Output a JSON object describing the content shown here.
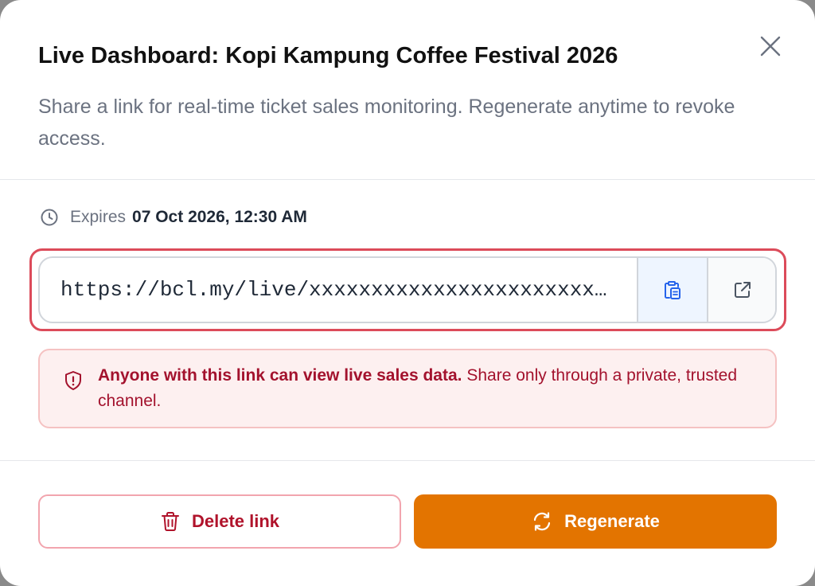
{
  "dialog": {
    "title": "Live Dashboard: Kopi Kampung Coffee Festival 2026",
    "subtitle": "Share a link for real-time ticket sales monitoring. Regenerate anytime to revoke access.",
    "close_icon": "close-icon"
  },
  "expiry": {
    "label": "Expires",
    "value": "07 Oct 2026, 12:30 AM",
    "icon": "clock-icon"
  },
  "link": {
    "url": "https://bcl.my/live/xxxxxxxxxxxxxxxxxxxxxxxxxxxxxxxx",
    "copy_icon": "clipboard-copy-icon",
    "open_icon": "external-link-icon"
  },
  "warning": {
    "icon": "shield-alert-icon",
    "bold": "Anyone with this link can view live sales data.",
    "rest": " Share only through a private, trusted channel."
  },
  "actions": {
    "delete_label": "Delete link",
    "delete_icon": "trash-icon",
    "regenerate_label": "Regenerate",
    "regenerate_icon": "refresh-icon"
  },
  "colors": {
    "accent": "#e37400",
    "danger": "#b0132b",
    "focus_ring": "#dc4b5a",
    "copy_active": "#2563eb"
  }
}
